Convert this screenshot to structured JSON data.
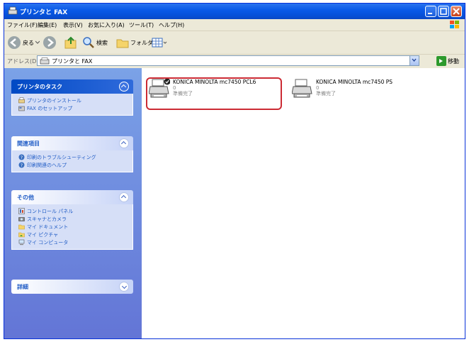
{
  "window": {
    "title": "プリンタと FAX"
  },
  "menu": [
    "ファイル(F)",
    "編集(E)",
    "表示(V)",
    "お気に入り(A)",
    "ツール(T)",
    "ヘルプ(H)"
  ],
  "toolbar": {
    "back": "戻る",
    "search": "検索",
    "folders": "フォルダ"
  },
  "address": {
    "label": "アドレス(D)",
    "value": "プリンタと FAX",
    "go": "移動"
  },
  "sidebar": {
    "printer_tasks": {
      "title": "プリンタのタスク",
      "items": [
        "プリンタのインストール",
        "FAX のセットアップ"
      ]
    },
    "see_also": {
      "title": "関連項目",
      "items": [
        "印刷のトラブルシューティング",
        "印刷関連のヘルプ"
      ]
    },
    "other_places": {
      "title": "その他",
      "items": [
        "コントロール パネル",
        "スキャナとカメラ",
        "マイ ドキュメント",
        "マイ ピクチャ",
        "マイ コンピュータ"
      ]
    },
    "details": {
      "title": "詳細"
    }
  },
  "printers": [
    {
      "name": "KONICA MINOLTA mc7450 PCL6",
      "count": "0",
      "status": "準備完了",
      "default": true
    },
    {
      "name": "KONICA MINOLTA mc7450 PS",
      "count": "0",
      "status": "準備完了",
      "default": false
    }
  ],
  "colors": {
    "title_bar": "#0a5ae8",
    "task_pane": "#6f8fe0",
    "highlight": "#cc2b34"
  }
}
